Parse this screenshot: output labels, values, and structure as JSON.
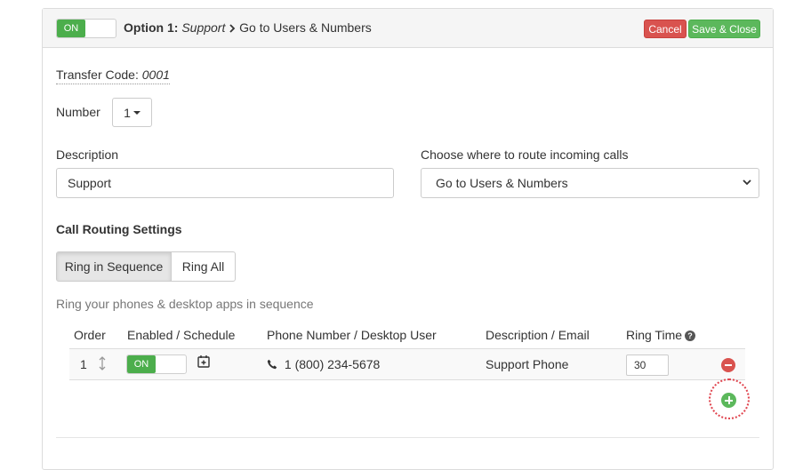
{
  "header": {
    "toggle_label": "ON",
    "option_prefix": "Option 1:",
    "option_name": "Support",
    "option_dest": "Go to Users & Numbers",
    "cancel_label": "Cancel",
    "save_close_label": "Save & Close"
  },
  "form": {
    "transfer_code_label": "Transfer Code:",
    "transfer_code_value": "0001",
    "number_label": "Number",
    "number_value": "1",
    "description_label": "Description",
    "description_value": "Support",
    "route_label": "Choose where to route incoming calls",
    "route_value": "Go to Users & Numbers"
  },
  "routing": {
    "section_title": "Call Routing Settings",
    "mode_sequence": "Ring in Sequence",
    "mode_all": "Ring All",
    "selected_mode": "Ring in Sequence",
    "helper_text": "Ring your phones & desktop apps in sequence"
  },
  "table": {
    "columns": [
      "Order",
      "Enabled / Schedule",
      "Phone Number / Desktop User",
      "Description / Email",
      "Ring Time"
    ],
    "rows": [
      {
        "order": "1",
        "enabled_label": "ON",
        "phone": "1 (800) 234-5678",
        "description": "Support Phone",
        "ring_time": "30"
      }
    ]
  },
  "colors": {
    "accent_green": "#5cb85c",
    "danger_red": "#d9534f"
  },
  "icons": {
    "schedule": "calendar-plus-icon",
    "phone": "phone-icon",
    "reorder": "drag-handle-icon",
    "remove": "remove-circle-icon",
    "add": "add-circle-icon",
    "help": "question-circle-icon"
  }
}
